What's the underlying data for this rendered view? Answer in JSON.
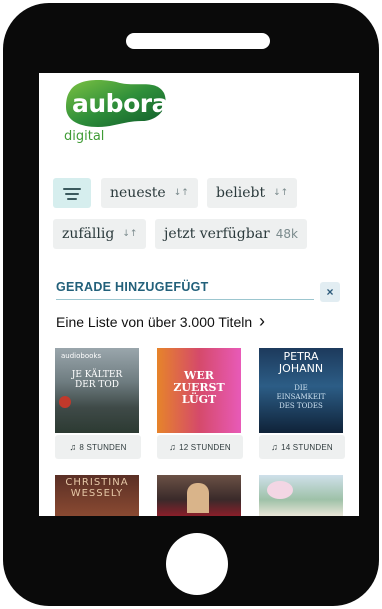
{
  "logo": {
    "word": "aubora",
    "sub": "digital"
  },
  "filters": {
    "menu_icon": "menu-icon",
    "sort_icon": "↓↑",
    "items": [
      {
        "label": "neueste"
      },
      {
        "label": "beliebt"
      },
      {
        "label": "zufällig"
      },
      {
        "label": "jetzt verfügbar",
        "count": "48k"
      }
    ]
  },
  "section": {
    "title": "GERADE HINZUGEFÜGT",
    "close": "×",
    "subtitle": "Eine Liste von über 3.000 Titeln",
    "chevron": "›"
  },
  "books": [
    {
      "duration": "8 STUNDEN",
      "cover_badge": "audiobooks",
      "cover_title": "JE KÄLTER DER TOD"
    },
    {
      "duration": "12 STUNDEN",
      "cover_title": "WER ZUERST LÜGT"
    },
    {
      "duration": "14 STUNDEN",
      "cover_author": "PETRA JOHANN",
      "cover_title": "DIE EINSAMKEIT DES TODES"
    },
    {
      "cover_author": "CHRISTINA WESSELY"
    },
    {},
    {}
  ],
  "headphone_icon": "headphones-icon"
}
